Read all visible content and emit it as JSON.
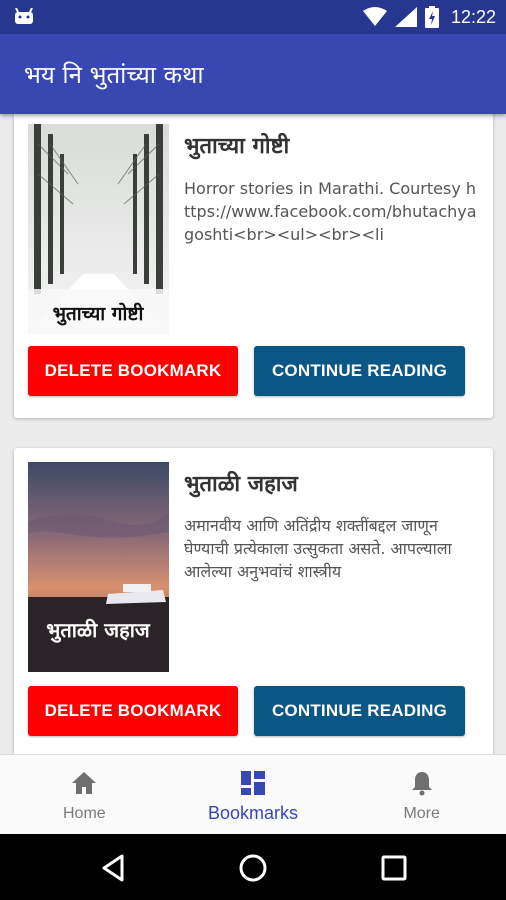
{
  "app": {
    "title": "भय नि भुतांच्या कथा",
    "brand_color": "#3748b3",
    "status_bar_color": "#27378f"
  },
  "status_bar": {
    "time": "12:22",
    "icons": [
      "android-icon",
      "wifi-icon",
      "signal-icon",
      "battery-charging-icon"
    ]
  },
  "bookmarks": [
    {
      "title": "भुताच्या गोष्टी",
      "description": "Horror stories in Marathi. Courtesy https://www.facebook.com/bhutachyagoshti<br><ul><br><li",
      "cover_text": "भुताच्या गोष्टी",
      "delete_label": "DELETE BOOKMARK",
      "continue_label": "CONTINUE READING"
    },
    {
      "title": "भुताळी जहाज",
      "description": "अमानवीय आणि अतिंद्रीय शक्तींबद्दल जाणून घेण्याची प्रत्येकाला उत्सुकता असते. आपल्याला आलेल्या अनुभवांचं शास्त्रीय",
      "cover_text": "भुताळी जहाज",
      "delete_label": "DELETE BOOKMARK",
      "continue_label": "CONTINUE READING"
    }
  ],
  "colors": {
    "delete_button": "#ff0000",
    "continue_button": "#0a5684"
  },
  "bottom_nav": {
    "items": [
      {
        "label": "Home",
        "icon": "home-icon",
        "active": false
      },
      {
        "label": "Bookmarks",
        "icon": "bookmarks-grid-icon",
        "active": true
      },
      {
        "label": "More",
        "icon": "bell-icon",
        "active": false
      }
    ]
  },
  "system_nav": {
    "icons": [
      "back-icon",
      "home-circle-icon",
      "recents-icon"
    ]
  }
}
